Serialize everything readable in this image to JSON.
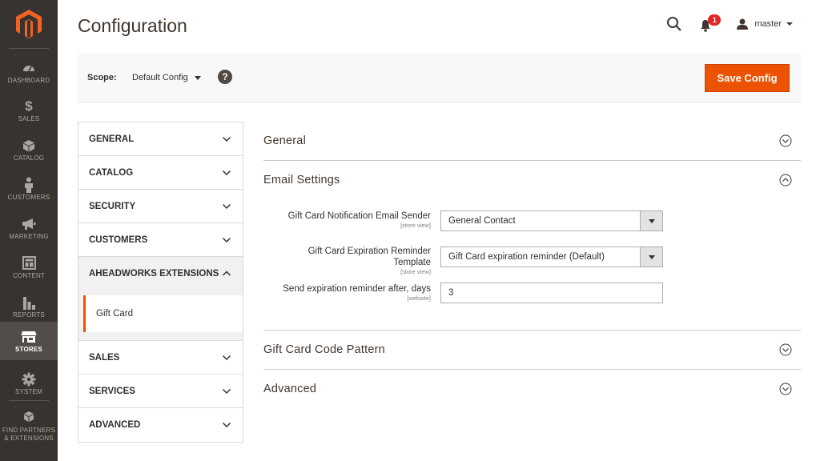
{
  "nav": {
    "items": [
      {
        "label": "DASHBOARD",
        "icon": "dashboard-icon"
      },
      {
        "label": "SALES",
        "icon": "dollar-icon"
      },
      {
        "label": "CATALOG",
        "icon": "box-icon"
      },
      {
        "label": "CUSTOMERS",
        "icon": "person-icon"
      },
      {
        "label": "MARKETING",
        "icon": "megaphone-icon"
      },
      {
        "label": "CONTENT",
        "icon": "layout-icon"
      },
      {
        "label": "REPORTS",
        "icon": "bar-chart-icon"
      },
      {
        "label": "STORES",
        "icon": "store-icon"
      },
      {
        "label": "SYSTEM",
        "icon": "gear-icon"
      },
      {
        "label": "FIND PARTNERS & EXTENSIONS",
        "icon": "cubes-icon"
      }
    ],
    "active": "STORES"
  },
  "header": {
    "title": "Configuration",
    "notification_count": "1",
    "user_name": "master"
  },
  "scope": {
    "label": "Scope:",
    "value": "Default Config",
    "help": "?"
  },
  "actions": {
    "save_label": "Save Config"
  },
  "tabs": {
    "items": [
      {
        "label": "GENERAL"
      },
      {
        "label": "CATALOG"
      },
      {
        "label": "SECURITY"
      },
      {
        "label": "CUSTOMERS"
      },
      {
        "label": "AHEADWORKS EXTENSIONS"
      },
      {
        "label": "SALES"
      },
      {
        "label": "SERVICES"
      },
      {
        "label": "ADVANCED"
      }
    ],
    "subitem": "Gift Card"
  },
  "sections": {
    "general": "General",
    "email": "Email Settings",
    "code_pattern": "Gift Card Code Pattern",
    "advanced": "Advanced"
  },
  "fields": {
    "sender": {
      "label": "Gift Card Notification Email Sender",
      "scope": "[store view]",
      "value": "General Contact"
    },
    "template": {
      "label_line1": "Gift Card Expiration Reminder",
      "label_line2": "Template",
      "scope": "[store view]",
      "value": "Gift Card expiration reminder (Default)"
    },
    "days": {
      "label": "Send expiration reminder after, days",
      "scope": "[website]",
      "value": "3"
    }
  },
  "colors": {
    "accent": "#eb5202",
    "nav_bg": "#373330",
    "badge": "#e22626"
  }
}
